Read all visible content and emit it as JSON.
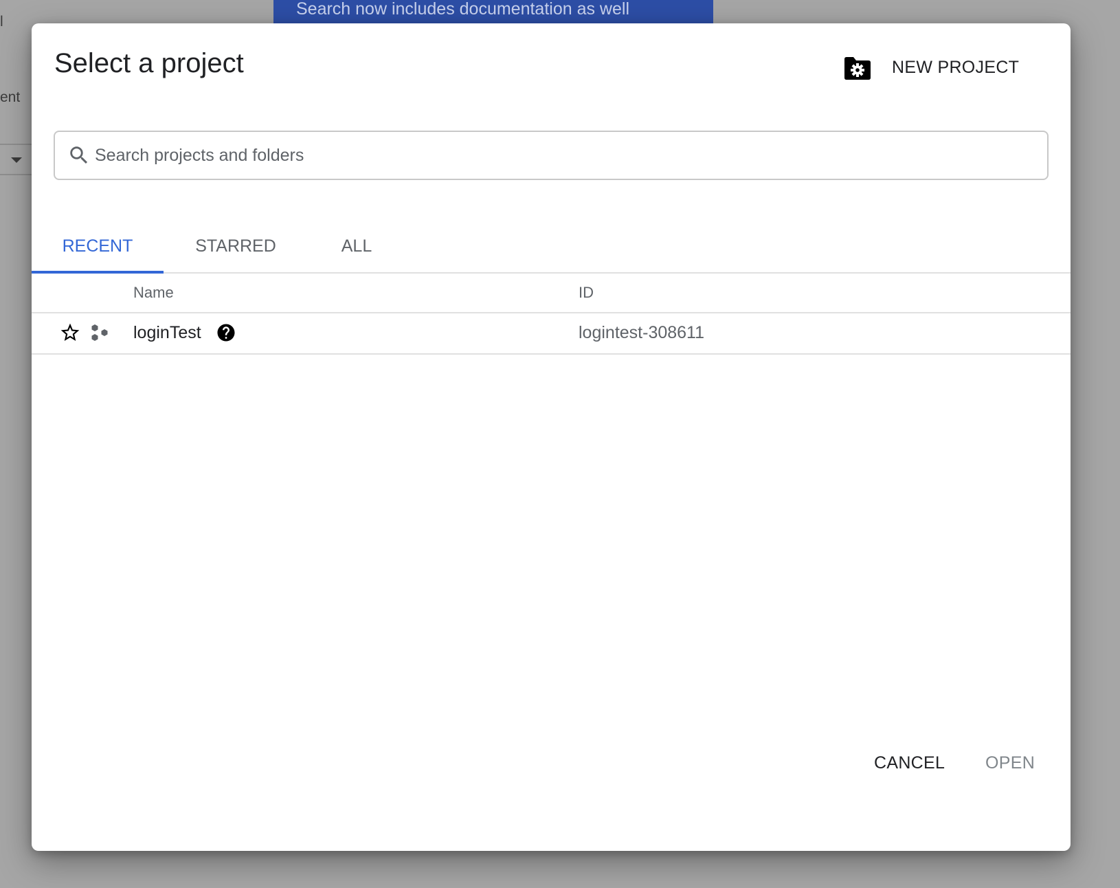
{
  "background": {
    "banner_text": "Search now includes documentation as well",
    "fragment_top": "l",
    "fragment_mid": "ent"
  },
  "dialog": {
    "title": "Select a project",
    "new_project_label": "NEW PROJECT",
    "folder_settings_icon": "folder-gear-icon"
  },
  "search": {
    "placeholder": "Search projects and folders",
    "value": ""
  },
  "tabs": [
    {
      "label": "RECENT",
      "active": true
    },
    {
      "label": "STARRED",
      "active": false
    },
    {
      "label": "ALL",
      "active": false
    }
  ],
  "table": {
    "columns": {
      "name": "Name",
      "id": "ID"
    },
    "rows": [
      {
        "name": "loginTest",
        "id": "logintest-308611",
        "starred": false,
        "icon": "project-hexagons-icon"
      }
    ]
  },
  "actions": {
    "cancel_label": "CANCEL",
    "open_label": "OPEN"
  },
  "colors": {
    "accent": "#3367d6",
    "banner": "#2d4ea6",
    "overlay": "#a6a6a6"
  }
}
